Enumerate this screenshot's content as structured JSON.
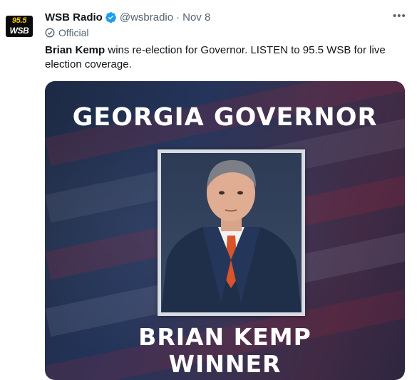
{
  "account": {
    "avatar_freq": "95.5",
    "avatar_call": "WSB",
    "display_name": "WSB Radio",
    "handle": "@wsbradio",
    "separator": "·",
    "date": "Nov 8",
    "label": "Official",
    "verified_color": "#1d9bf0"
  },
  "tweet": {
    "text_bold": "Brian Kemp",
    "text_rest": " wins re-election for Governor. LISTEN to 95.5 WSB for live election coverage."
  },
  "media": {
    "headline": "GEORGIA GOVERNOR",
    "name_line": "BRIAN KEMP",
    "result_line": "WINNER"
  },
  "more_icon": "more-horizontal-icon"
}
